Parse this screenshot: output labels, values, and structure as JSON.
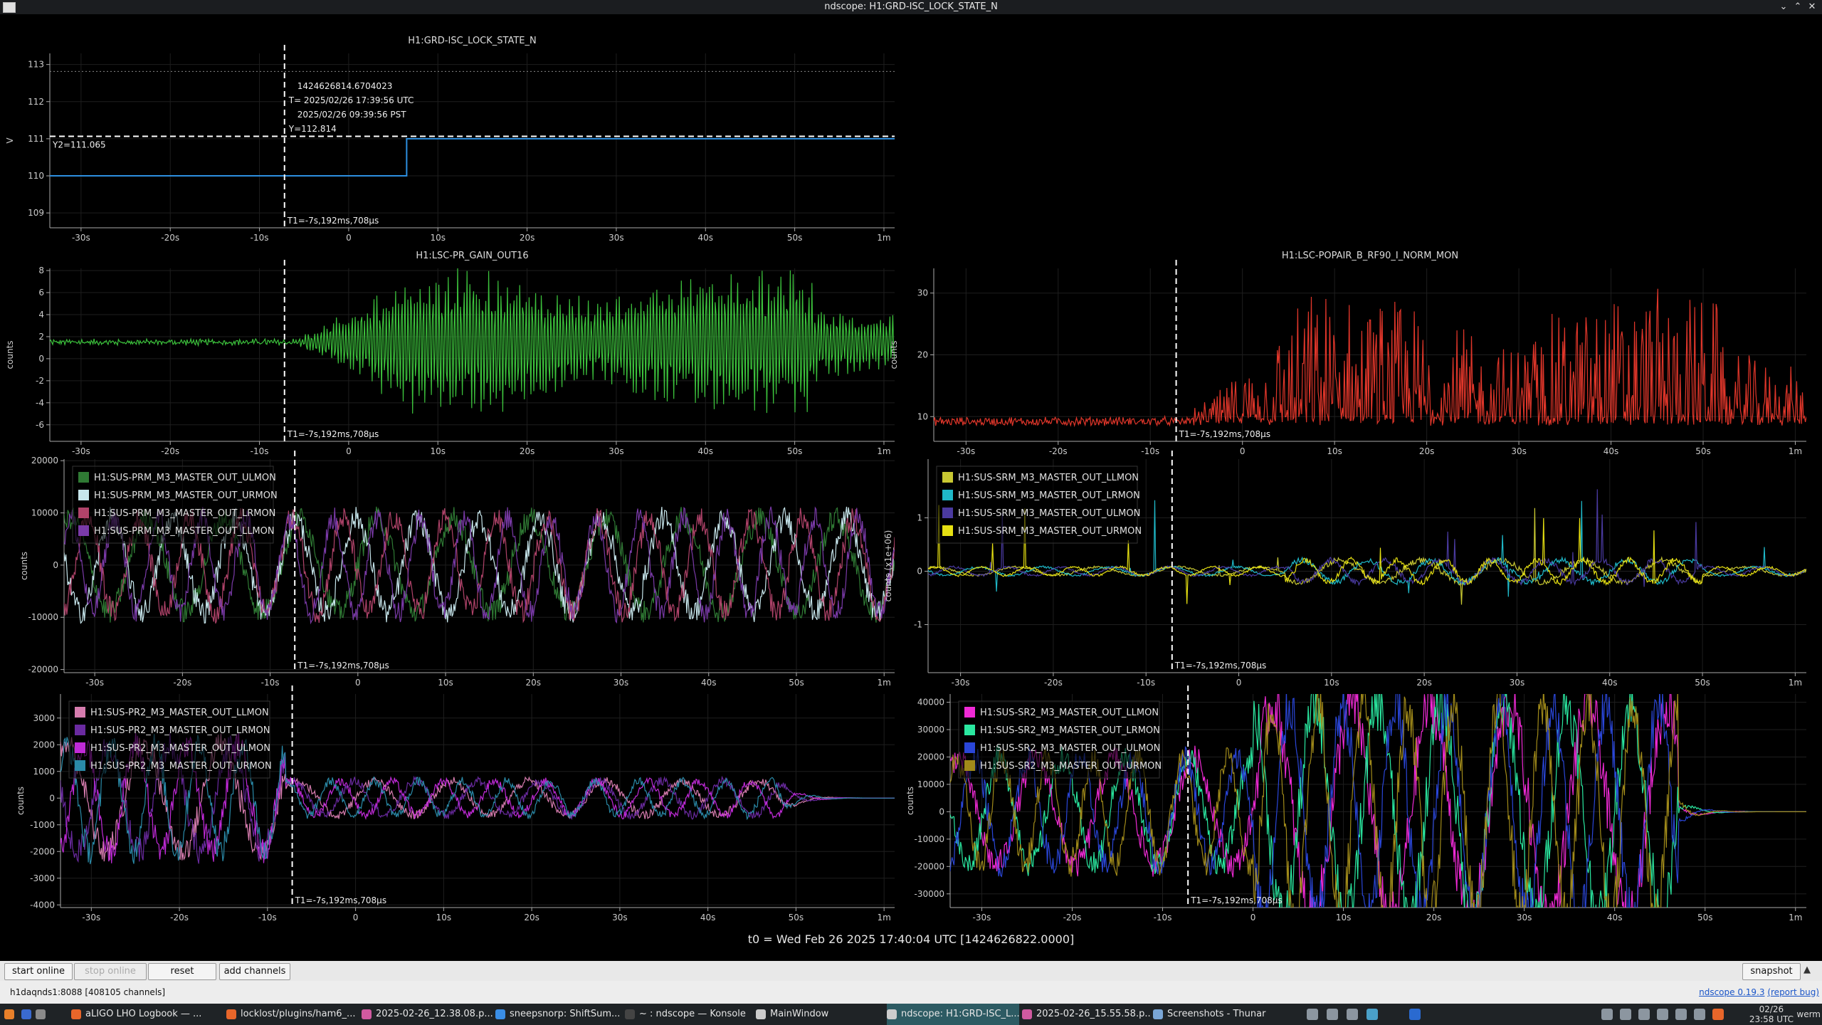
{
  "window": {
    "title": "ndscope: H1:GRD-ISC_LOCK_STATE_N"
  },
  "colors": {
    "background": "#000000",
    "panel_bg": "#e8e8e8",
    "taskbar_bg": "#1f2326",
    "cursor": "#ffffff"
  },
  "xaxis": {
    "ticks": [
      -30,
      -20,
      -10,
      0,
      10,
      20,
      30,
      40,
      50,
      60
    ],
    "tick_labels": [
      "-30s",
      "-20s",
      "-10s",
      "0",
      "10s",
      "20s",
      "30s",
      "40s",
      "50s",
      "1m"
    ],
    "range": [
      -33.5,
      61.2
    ]
  },
  "cursor": {
    "t1": -7.192708,
    "label": "T1=-7s,192ms,708µs"
  },
  "plots": [
    {
      "id": "lock-state",
      "title": "H1:GRD-ISC_LOCK_STATE_N",
      "ylabel": "V",
      "ylim": [
        108.6,
        113.3
      ],
      "yticks": [
        109,
        110,
        111,
        112,
        113
      ],
      "crosshair": {
        "gps": "1424626814.6704023",
        "utc": "T= 2025/02/26 17:39:56 UTC",
        "pst": "2025/02/26 09:39:56 PST",
        "y": "Y=112.814",
        "y2": "Y2=111.065"
      },
      "top_guide": 112.814,
      "y2_guide": 111.065,
      "series": [
        {
          "color": "#2d8fe0",
          "x": [
            -33.5,
            6.5,
            6.5,
            61.2
          ],
          "y": [
            110,
            110,
            111,
            111
          ]
        }
      ]
    },
    {
      "id": "pr-gain",
      "title": "H1:LSC-PR_GAIN_OUT16",
      "ylabel": "counts",
      "ylim": [
        -7.5,
        8.2
      ],
      "yticks": [
        -6,
        -4,
        -2,
        0,
        2,
        4,
        6,
        8
      ],
      "series": [
        {
          "color": "#3cc23c",
          "type": "burst",
          "base": 1.5,
          "amp": 6
        }
      ]
    },
    {
      "id": "popair",
      "title": "H1:LSC-POPAIR_B_RF90_I_NORM_MON",
      "ylabel": "counts",
      "ylim": [
        6,
        34
      ],
      "yticks": [
        10,
        20,
        30
      ],
      "series": [
        {
          "color": "#e0362a",
          "type": "spiky",
          "base": 8.5,
          "amp": 22
        }
      ]
    },
    {
      "id": "prm-m3",
      "title": "",
      "ylabel": "counts",
      "ylim": [
        -20600,
        20300
      ],
      "yticks": [
        -20000,
        -10000,
        0,
        10000,
        20000
      ],
      "legend": [
        {
          "label": "H1:SUS-PRM_M3_MASTER_OUT_ULMON",
          "color": "#2f7a34"
        },
        {
          "label": "H1:SUS-PRM_M3_MASTER_OUT_URMON",
          "color": "#c7e6ec"
        },
        {
          "label": "H1:SUS-PRM_M3_MASTER_OUT_LRMON",
          "color": "#b0436a"
        },
        {
          "label": "H1:SUS-PRM_M3_MASTER_OUT_LLMON",
          "color": "#7a3aa8"
        }
      ]
    },
    {
      "id": "srm-m3",
      "title": "",
      "ylabel": "counts (x1e+06)",
      "ylim": [
        -1.9,
        2.1
      ],
      "yticks": [
        -1,
        0,
        1
      ],
      "legend": [
        {
          "label": "H1:SUS-SRM_M3_MASTER_OUT_LLMON",
          "color": "#c8c832"
        },
        {
          "label": "H1:SUS-SRM_M3_MASTER_OUT_LRMON",
          "color": "#1fb8c8"
        },
        {
          "label": "H1:SUS-SRM_M3_MASTER_OUT_ULMON",
          "color": "#4a3aa0"
        },
        {
          "label": "H1:SUS-SRM_M3_MASTER_OUT_URMON",
          "color": "#e6e012"
        }
      ]
    },
    {
      "id": "pr2-m3",
      "title": "",
      "ylabel": "counts",
      "ylim": [
        -4100,
        3900
      ],
      "yticks": [
        -4000,
        -3000,
        -2000,
        -1000,
        0,
        1000,
        2000,
        3000
      ],
      "legend": [
        {
          "label": "H1:SUS-PR2_M3_MASTER_OUT_LLMON",
          "color": "#d67cae"
        },
        {
          "label": "H1:SUS-PR2_M3_MASTER_OUT_LRMON",
          "color": "#6a2aa0"
        },
        {
          "label": "H1:SUS-PR2_M3_MASTER_OUT_ULMON",
          "color": "#c02ad8"
        },
        {
          "label": "H1:SUS-PR2_M3_MASTER_OUT_URMON",
          "color": "#2a8aa8"
        }
      ]
    },
    {
      "id": "sr2-m3",
      "title": "",
      "ylabel": "counts",
      "ylim": [
        -35000,
        43000
      ],
      "yticks": [
        -30000,
        -20000,
        -10000,
        0,
        10000,
        20000,
        30000,
        40000
      ],
      "legend": [
        {
          "label": "H1:SUS-SR2_M3_MASTER_OUT_LLMON",
          "color": "#f02ad6"
        },
        {
          "label": "H1:SUS-SR2_M3_MASTER_OUT_LRMON",
          "color": "#2ae8a0"
        },
        {
          "label": "H1:SUS-SR2_M3_MASTER_OUT_ULMON",
          "color": "#2a46d8"
        },
        {
          "label": "H1:SUS-SR2_M3_MASTER_OUT_URMON",
          "color": "#a08a1a"
        }
      ]
    }
  ],
  "t0_label": "t0 = Wed Feb 26 2025 17:40:04 UTC [1424626822.0000]",
  "controls": {
    "start_online": "start online",
    "stop_online": "stop online",
    "reset": "reset",
    "add_channels": "add channels",
    "snapshot": "snapshot"
  },
  "status": {
    "server": "h1daqnds1:8088",
    "channels": "[408105 channels]",
    "version_link": "ndscope 0.19.3",
    "report_bug": "(report bug)"
  },
  "taskbar": {
    "items": [
      {
        "label": "aLIGO LHO Logbook — ...",
        "icon_color": "#e8662a"
      },
      {
        "label": "locklost/plugins/ham6_...",
        "icon_color": "#e8662a"
      },
      {
        "label": "2025-02-26_12.38.08.p...",
        "icon_color": "#d05aa0"
      },
      {
        "label": "sneepsnorp: ShiftSum...",
        "icon_color": "#3a8ee6"
      },
      {
        "label": "~ : ndscope — Konsole",
        "icon_color": "#444"
      },
      {
        "label": "MainWindow",
        "icon_color": "#ccc"
      },
      {
        "label": "ndscope: H1:GRD-ISC_L...",
        "icon_color": "#ccc"
      },
      {
        "label": "2025-02-26_15.55.58.p...",
        "icon_color": "#d05aa0"
      },
      {
        "label": "Screenshots - Thunar",
        "icon_color": "#7aa6d6"
      }
    ],
    "clock_date": "02/26",
    "clock_time": "23:58 UTC",
    "user": "werm"
  }
}
